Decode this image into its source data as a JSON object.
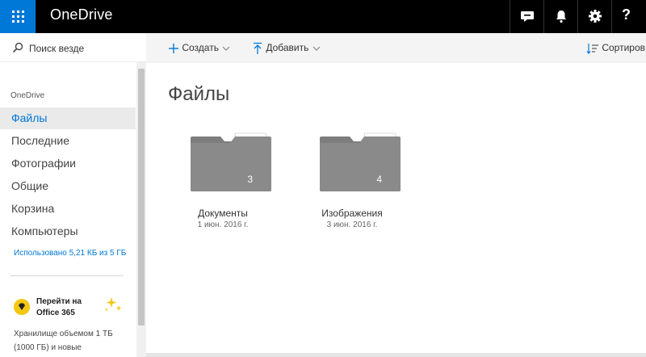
{
  "topbar": {
    "brand": "OneDrive",
    "icons": [
      "waffle-icon",
      "chat-icon",
      "bell-icon",
      "gear-icon",
      "help-icon"
    ],
    "help_label": "?"
  },
  "colors": {
    "accent": "#0078d7",
    "topbar_bg": "#000000",
    "folder": "#8a8a8a",
    "promo": "#f2c811"
  },
  "search": {
    "placeholder": "Поиск везде"
  },
  "nav": {
    "heading": "OneDrive",
    "items": [
      {
        "label": "Файлы",
        "active": true
      },
      {
        "label": "Последние"
      },
      {
        "label": "Фотографии"
      },
      {
        "label": "Общие"
      },
      {
        "label": "Корзина"
      },
      {
        "label": "Компьютеры"
      }
    ],
    "storage": "Использовано 5,21 КБ из 5 ГБ"
  },
  "promo": {
    "title": "Перейти на Office 365",
    "description": "Хранилище объемом 1 ТБ (1000 ГБ) и новые"
  },
  "commands": {
    "create": "Создать",
    "upload": "Добавить",
    "sort": "Сортиров"
  },
  "main": {
    "title": "Файлы",
    "folders": [
      {
        "name": "Документы",
        "date": "1 июн. 2016 г.",
        "count": "3"
      },
      {
        "name": "Изображения",
        "date": "3 июн. 2016 г.",
        "count": "4"
      }
    ]
  }
}
